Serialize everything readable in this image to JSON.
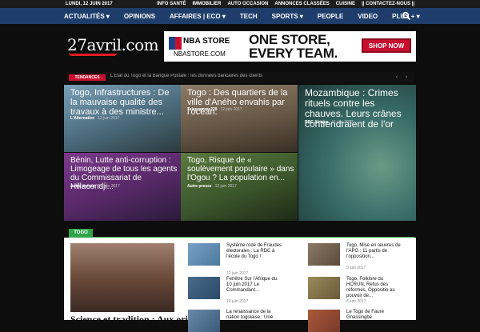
{
  "topbar": {
    "date": "LUNDI, 12 JUIN 2017",
    "links": [
      "INFO SANTÉ",
      "IMMOBILIER",
      "AUTO OCCASION",
      "ANNONCES CLASSÉES",
      "CUISINE",
      "|| CONTACTEZ-NOUS ||"
    ]
  },
  "nav": {
    "items": [
      "ACTUALITÉS ▾",
      "OPINIONS",
      "AFFAIRES | ECO ▾",
      "TECH",
      "SPORTS ▾",
      "PEOPLE",
      "VIDEO",
      "PLUS + ▾"
    ]
  },
  "logo": {
    "name": "27avril",
    "tld": ".com"
  },
  "ad": {
    "brand": "NBA STORE",
    "domain": "NBASTORE.COM",
    "slogan_line1": "ONE STORE,",
    "slogan_line2": "EVERY TEAM.",
    "cta": "SHOP NOW"
  },
  "trending": {
    "label": "TENDANCES",
    "ticker": "L'Etat du Togo et la Banque Postale : les données bancaires des clients",
    "prev": "‹",
    "next": "›"
  },
  "grid": [
    {
      "title": "Togo, Infrastructures : De la mauvaise qualité des travaux à des ministre...",
      "source": "L'Alternative",
      "date": "12 juin 2017",
      "color": "#5a7a9a"
    },
    {
      "title": "Togo : Des quartiers de la ville d'Aného envahis par l'océan.",
      "source": "Telegramme228",
      "date": "12 juin 2017",
      "color": "#6b5a48"
    },
    {
      "title": "Mozambique : Crimes rituels contre les chauves. Leurs crânes contiendraient de l'or",
      "source": "BBC Afrique",
      "date": "11 juin 2017",
      "color": "#3a6e6a"
    },
    {
      "title": "Bénin, Lutte anti-corruption : Limogeage de tous les agents du Commissariat de Hillacondji...",
      "source": "Autre presse",
      "date": "12 juin 2017",
      "color": "#6a2e7a"
    },
    {
      "title": "Togo, Risque de « soulèvement populaire » dans l'Ogou ? La population en...",
      "source": "Autre presse",
      "date": "12 juin 2017",
      "color": "#3e5a2e"
    }
  ],
  "section": {
    "tag": "TOGO",
    "big_title": "Science et tradition : Aux origines",
    "items": [
      {
        "title": "Système rodé de Fraudes électorales : La RDC à l'école du Togo !",
        "date": "12 juin 2017",
        "color": "#4a7a9a"
      },
      {
        "title": "Togo, Mise en œuvres de l'APG : 11 partis de l'opposition...",
        "date": "9 juin 2017",
        "color": "#5a4a3a"
      },
      {
        "title": "Fenêtre Sur l'Afrique du 10 juin 2017 Le Commandant...",
        "date": "10 juin 2017",
        "color": "#2a4a6a"
      },
      {
        "title": "Togo, Folklore du HCRUN, Refus des réformes, Oppositio au pouvoir de...",
        "date": "8 juin 2017",
        "color": "#6a5a3a"
      },
      {
        "title": "La renaissance de la nation togolaise : Une responsabilité",
        "date": "",
        "color": "#3a5a7a"
      },
      {
        "title": "Le Togo de Faure Gnassingbé",
        "date": "",
        "color": "#7a3a2a"
      }
    ]
  }
}
